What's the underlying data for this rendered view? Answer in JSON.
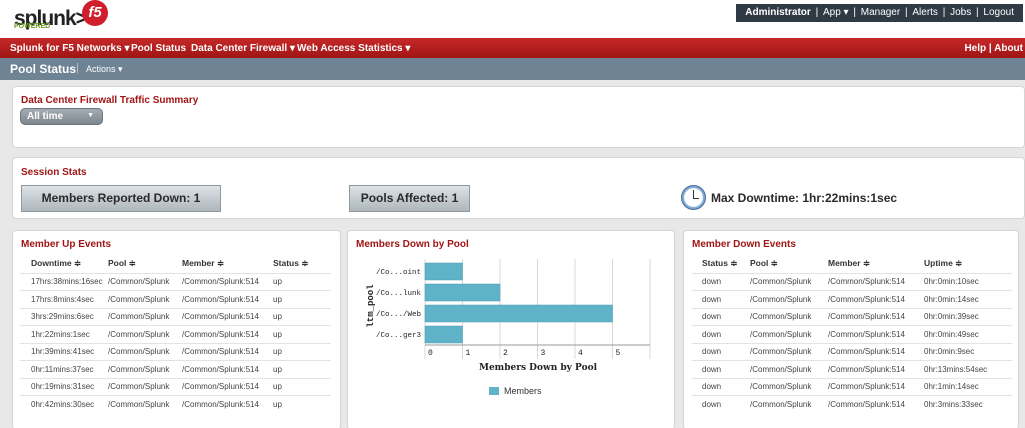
{
  "topbar": {
    "logo_text": "splunk>",
    "powered_text": "POWERED",
    "f5_text": "f5",
    "user": "Administrator",
    "menu": [
      "App ▾",
      "Manager",
      "Alerts",
      "Jobs",
      "Logout"
    ]
  },
  "appbar": {
    "items": [
      "Splunk for F5 Networks ▾",
      "Pool Status",
      "Data Center Firewall ▾",
      "Web Access Statistics ▾"
    ],
    "help": "Help",
    "about": "About"
  },
  "titlebar": {
    "title": "Pool Status",
    "actions": "Actions ▾"
  },
  "traffic_panel": {
    "title": "Data Center Firewall Traffic Summary",
    "timerange": "All time"
  },
  "session_panel": {
    "title": "Session Stats",
    "members_down": "Members Reported Down: 1",
    "pools_affected": "Pools Affected: 1",
    "max_downtime": "Max Downtime: 1hr:22mins:1sec"
  },
  "member_up": {
    "title": "Member Up Events",
    "columns": [
      "Downtime ≑",
      "Pool ≑",
      "Member ≑",
      "Status ≑"
    ],
    "rows": [
      [
        "17hrs:38mins:16sec",
        "/Common/Splunk",
        "/Common/Splunk:514",
        "up"
      ],
      [
        "17hrs:8mins:4sec",
        "/Common/Splunk",
        "/Common/Splunk:514",
        "up"
      ],
      [
        "3hrs:29mins:6sec",
        "/Common/Splunk",
        "/Common/Splunk:514",
        "up"
      ],
      [
        "1hr:22mins:1sec",
        "/Common/Splunk",
        "/Common/Splunk:514",
        "up"
      ],
      [
        "1hr:39mins:41sec",
        "/Common/Splunk",
        "/Common/Splunk:514",
        "up"
      ],
      [
        "0hr:11mins:37sec",
        "/Common/Splunk",
        "/Common/Splunk:514",
        "up"
      ],
      [
        "0hr:19mins:31sec",
        "/Common/Splunk",
        "/Common/Splunk:514",
        "up"
      ],
      [
        "0hr:42mins:30sec",
        "/Common/Splunk",
        "/Common/Splunk:514",
        "up"
      ]
    ]
  },
  "member_down": {
    "title": "Member Down Events",
    "columns": [
      "Status ≑",
      "Pool ≑",
      "Member ≑",
      "Uptime ≑"
    ],
    "rows": [
      [
        "down",
        "/Common/Splunk",
        "/Common/Splunk:514",
        "0hr:0min:10sec"
      ],
      [
        "down",
        "/Common/Splunk",
        "/Common/Splunk:514",
        "0hr:0min:14sec"
      ],
      [
        "down",
        "/Common/Splunk",
        "/Common/Splunk:514",
        "0hr:0min:39sec"
      ],
      [
        "down",
        "/Common/Splunk",
        "/Common/Splunk:514",
        "0hr:0min:49sec"
      ],
      [
        "down",
        "/Common/Splunk",
        "/Common/Splunk:514",
        "0hr:0min:9sec"
      ],
      [
        "down",
        "/Common/Splunk",
        "/Common/Splunk:514",
        "0hr:13mins:54sec"
      ],
      [
        "down",
        "/Common/Splunk",
        "/Common/Splunk:514",
        "0hr:1min:14sec"
      ],
      [
        "down",
        "/Common/Splunk",
        "/Common/Splunk:514",
        "0hr:3mins:33sec"
      ]
    ]
  },
  "chart_panel": {
    "title": "Members Down by Pool"
  },
  "chart_data": {
    "type": "bar",
    "orientation": "horizontal",
    "title": "Members Down by Pool",
    "ylabel": "ltm_pool",
    "xlabel": "",
    "categories": [
      "/Co...oint",
      "/Co...lunk",
      "/Co.../Web",
      "/Co...ger3"
    ],
    "series": [
      {
        "name": "Members",
        "values": [
          1,
          2,
          5,
          1
        ],
        "color": "#5fb3c8"
      }
    ],
    "xlim": [
      0,
      6
    ],
    "xticks": [
      "0",
      "1",
      "2",
      "3",
      "4",
      "5"
    ],
    "grid": true,
    "legend": "bottom"
  }
}
